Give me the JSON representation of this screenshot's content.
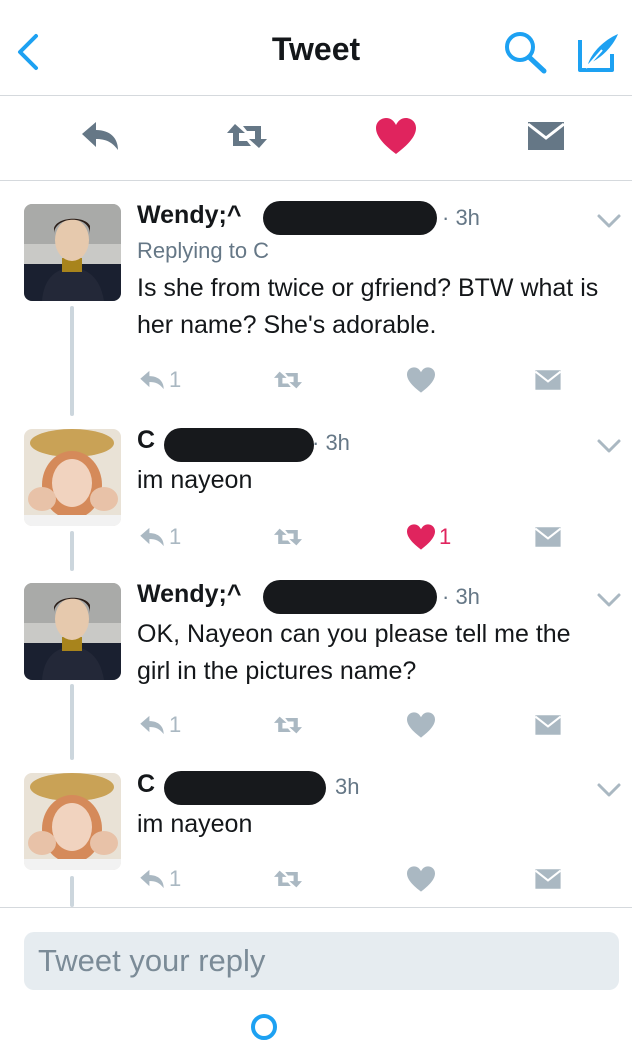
{
  "header": {
    "title": "Tweet",
    "back_icon": "back-chevron-icon",
    "search_icon": "search-icon",
    "compose_icon": "compose-icon"
  },
  "action_bar": {
    "items": [
      "reply-icon",
      "retweet-icon",
      "like-icon",
      "message-icon"
    ],
    "like_color": "#e0245e"
  },
  "tweets": [
    {
      "name": "Wendy;^",
      "time": "· 3h",
      "replying_to": "Replying to C",
      "text": "Is she from twice or gfriend? BTW what is her name? She's adorable.",
      "reply_count": "1",
      "like_count": "",
      "liked": false
    },
    {
      "name": "C",
      "time": "· 3h",
      "text": "im nayeon",
      "reply_count": "1",
      "like_count": "1",
      "liked": true
    },
    {
      "name": "Wendy;^",
      "time": "· 3h",
      "text": "OK, Nayeon can you please tell me the girl in the pictures name?",
      "reply_count": "1",
      "like_count": "",
      "liked": false
    },
    {
      "name": "C",
      "time": "3h",
      "text": "im nayeon",
      "reply_count": "1",
      "like_count": "",
      "liked": false
    }
  ],
  "reply_box": {
    "placeholder": "Tweet your reply"
  },
  "colors": {
    "accent": "#1da1f2",
    "action_gray": "#aab8c2",
    "header_icon_gray": "#657786",
    "like_red": "#e0245e"
  }
}
